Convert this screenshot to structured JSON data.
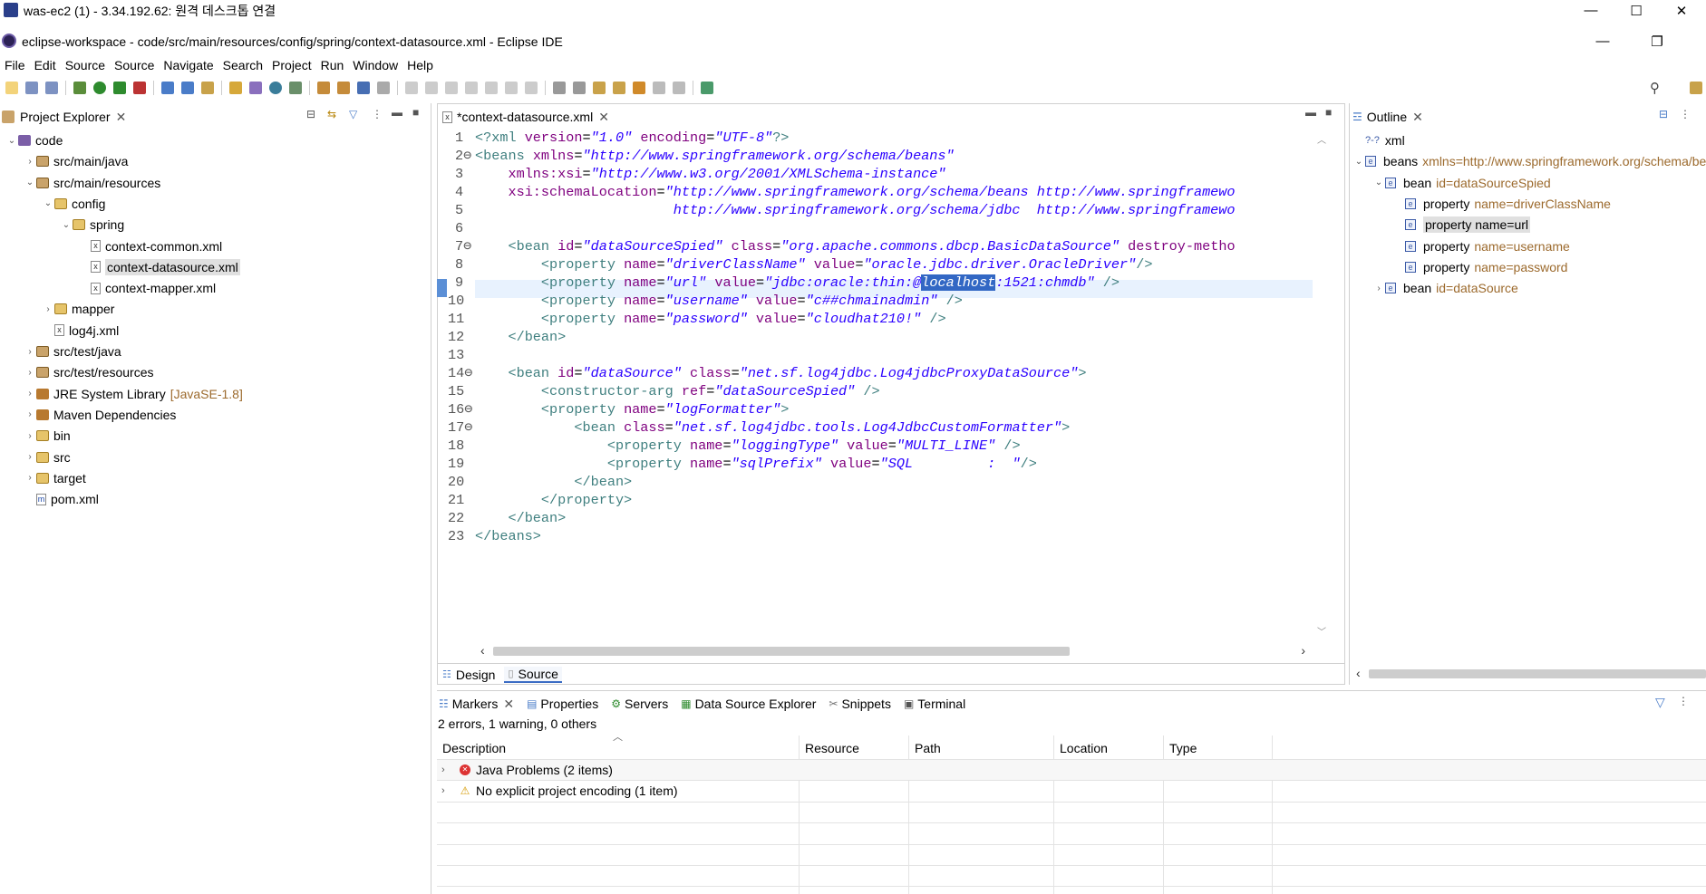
{
  "rdp": {
    "title": "was-ec2 (1) - 3.34.192.62: 원격 데스크톱 연결",
    "minimize": "—",
    "maximize": "☐",
    "close": "✕"
  },
  "ide": {
    "title": "eclipse-workspace - code/src/main/resources/config/spring/context-datasource.xml - Eclipse IDE",
    "minimize": "—",
    "restore": "❐"
  },
  "menu": [
    "File",
    "Edit",
    "Source",
    "Source",
    "Navigate",
    "Search",
    "Project",
    "Run",
    "Window",
    "Help"
  ],
  "project_explorer": {
    "tab_label": "Project Explorer",
    "items": [
      {
        "label": "code",
        "depth": 0,
        "twisty": "⌄",
        "icon": "project"
      },
      {
        "label": "src/main/java",
        "depth": 1,
        "twisty": "›",
        "icon": "package"
      },
      {
        "label": "src/main/resources",
        "depth": 1,
        "twisty": "⌄",
        "icon": "package"
      },
      {
        "label": "config",
        "depth": 2,
        "twisty": "⌄",
        "icon": "folder"
      },
      {
        "label": "spring",
        "depth": 3,
        "twisty": "⌄",
        "icon": "folder"
      },
      {
        "label": "context-common.xml",
        "depth": 4,
        "twisty": "",
        "icon": "xml"
      },
      {
        "label": "context-datasource.xml",
        "depth": 4,
        "twisty": "",
        "icon": "xml",
        "selected": true
      },
      {
        "label": "context-mapper.xml",
        "depth": 4,
        "twisty": "",
        "icon": "xml"
      },
      {
        "label": "mapper",
        "depth": 2,
        "twisty": "›",
        "icon": "folder"
      },
      {
        "label": "log4j.xml",
        "depth": 2,
        "twisty": "",
        "icon": "xml"
      },
      {
        "label": "src/test/java",
        "depth": 1,
        "twisty": "›",
        "icon": "package"
      },
      {
        "label": "src/test/resources",
        "depth": 1,
        "twisty": "›",
        "icon": "package"
      },
      {
        "label": "JRE System Library",
        "suffix": "[JavaSE-1.8]",
        "depth": 1,
        "twisty": "›",
        "icon": "library"
      },
      {
        "label": "Maven Dependencies",
        "depth": 1,
        "twisty": "›",
        "icon": "library"
      },
      {
        "label": "bin",
        "depth": 1,
        "twisty": "›",
        "icon": "folder"
      },
      {
        "label": "src",
        "depth": 1,
        "twisty": "›",
        "icon": "folder"
      },
      {
        "label": "target",
        "depth": 1,
        "twisty": "›",
        "icon": "folder"
      },
      {
        "label": "pom.xml",
        "depth": 1,
        "twisty": "",
        "icon": "maven"
      }
    ]
  },
  "editor": {
    "tab_label": "*context-datasource.xml",
    "bottom_tabs": [
      "Design",
      "Source"
    ],
    "line_numbers": [
      "1",
      "2⊖",
      "3",
      "4",
      "5",
      "6",
      "7⊖",
      "8",
      "9",
      "10",
      "11",
      "12",
      "13",
      "14⊖",
      "15",
      "16⊖",
      "17⊖",
      "18",
      "19",
      "20",
      "21",
      "22",
      "23"
    ]
  },
  "outline": {
    "tab_label": "Outline",
    "items": [
      {
        "label": "xml",
        "detail": "",
        "depth": 0,
        "twisty": "",
        "icon": "?-?"
      },
      {
        "label": "beans",
        "detail": "xmlns=http://www.springframework.org/schema/beans",
        "depth": 0,
        "twisty": "⌄",
        "icon": "e"
      },
      {
        "label": "bean",
        "detail": "id=dataSourceSpied",
        "depth": 1,
        "twisty": "⌄",
        "icon": "e"
      },
      {
        "label": "property",
        "detail": "name=driverClassName",
        "depth": 2,
        "twisty": "",
        "icon": "e"
      },
      {
        "label": "property name=url",
        "detail": "",
        "depth": 2,
        "twisty": "",
        "icon": "e",
        "selected": true
      },
      {
        "label": "property",
        "detail": "name=username",
        "depth": 2,
        "twisty": "",
        "icon": "e"
      },
      {
        "label": "property",
        "detail": "name=password",
        "depth": 2,
        "twisty": "",
        "icon": "e"
      },
      {
        "label": "bean",
        "detail": "id=dataSource",
        "depth": 1,
        "twisty": "›",
        "icon": "e"
      }
    ]
  },
  "bottom_panel": {
    "tabs": [
      "Markers",
      "Properties",
      "Servers",
      "Data Source Explorer",
      "Snippets",
      "Terminal"
    ],
    "summary": "2 errors, 1 warning, 0 others",
    "columns": [
      "Description",
      "Resource",
      "Path",
      "Location",
      "Type"
    ],
    "rows": [
      {
        "label": "Java Problems (2 items)",
        "severity": "error"
      },
      {
        "label": "No explicit project encoding (1 item)",
        "severity": "warning"
      }
    ]
  }
}
